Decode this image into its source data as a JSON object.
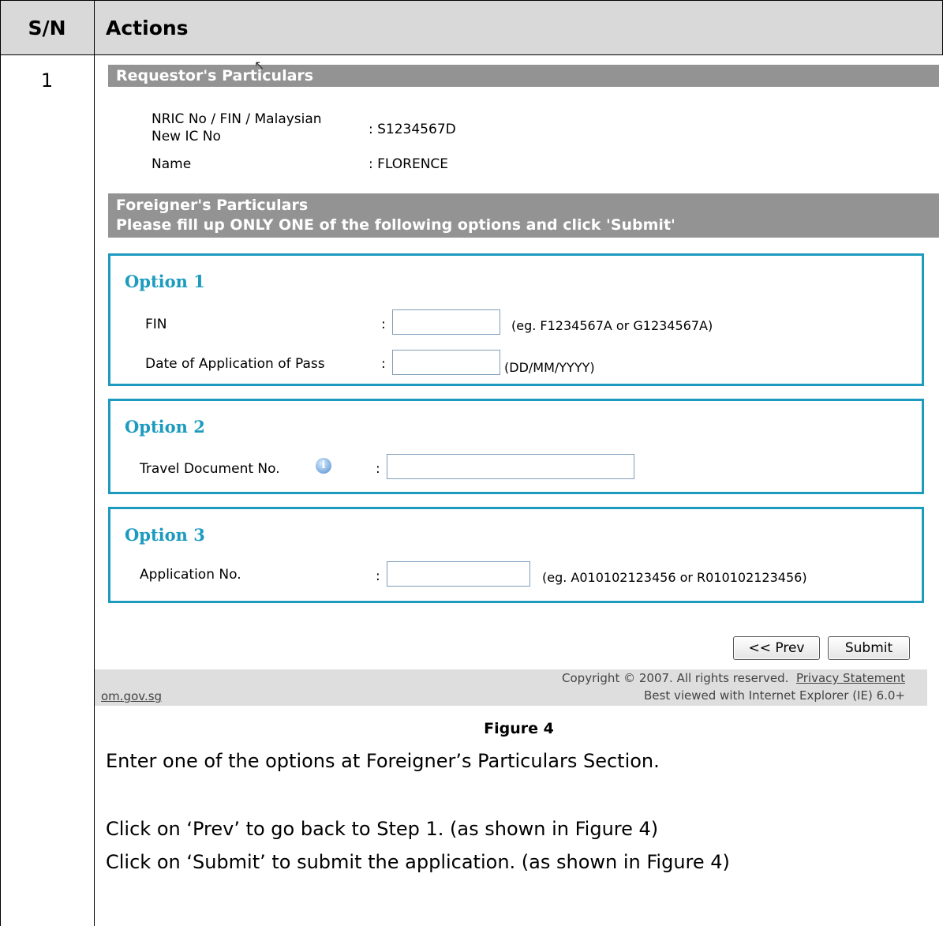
{
  "table": {
    "headers": {
      "sn": "S/N",
      "actions": "Actions"
    },
    "row": {
      "sn": "1"
    }
  },
  "form": {
    "requestor": {
      "heading": "Requestor's Particulars",
      "nric_label": "NRIC No / FIN / Malaysian",
      "nric_label_line2": "New IC No",
      "nric_value": ": S1234567D",
      "name_label": "Name",
      "name_value": ": FLORENCE"
    },
    "foreigner": {
      "heading": "Foreigner's Particulars",
      "instruction": "Please fill up ONLY ONE of the following options and click 'Submit'"
    },
    "option1": {
      "title": "Option 1",
      "fin_label": "FIN",
      "fin_value": "",
      "fin_hint": "(eg. F1234567A or G1234567A)",
      "date_label": "Date of Application of Pass",
      "date_value": "",
      "date_hint": "(DD/MM/YYYY)"
    },
    "option2": {
      "title": "Option 2",
      "travel_label": "Travel Document No.",
      "travel_value": ""
    },
    "option3": {
      "title": "Option 3",
      "app_label": "Application No.",
      "app_value": "",
      "app_hint": "(eg. A010102123456 or R010102123456)"
    },
    "colon": ":",
    "buttons": {
      "prev": "<< Prev",
      "submit": "Submit"
    },
    "footer": {
      "copyright": "Copyright © 2007. All rights reserved.",
      "privacy": "Privacy Statement",
      "best_viewed": "Best viewed with Internet Explorer (IE) 6.0+",
      "domain": "om.gov.sg"
    }
  },
  "figure_caption": "Figure 4",
  "instructions": [
    "Enter one of the options at Foreigner’s Particulars Section.",
    "Click on ‘Prev’ to go back to Step 1. (as shown in Figure 4)",
    "Click on ‘Submit’ to submit the application. (as shown in Figure 4)"
  ],
  "colors": {
    "header_bg": "#d9d9d9",
    "section_bar": "#939393",
    "option_accent": "#1c9bbf",
    "footer_bg": "#dedede"
  }
}
